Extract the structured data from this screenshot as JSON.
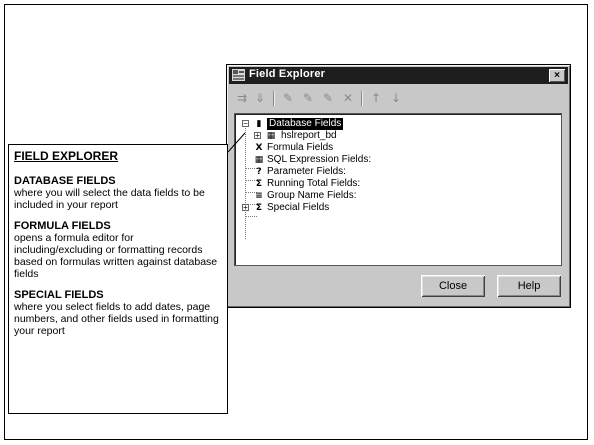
{
  "window": {
    "title": "Field Explorer",
    "close_glyph": "×",
    "toolbar_icons": [
      "insert-icon",
      "browse-icon",
      "new-icon",
      "edit-icon",
      "rename-icon",
      "delete-icon",
      "move-up-icon",
      "move-down-icon"
    ],
    "toolbar_glyphs": [
      "⇉",
      "⇓",
      "✎",
      "✎",
      "✎",
      "✕",
      "↑",
      "↓"
    ],
    "tree": [
      {
        "label": "Database Fields",
        "icon": "database-icon",
        "glyph": "▮",
        "expander": "−",
        "selected": true
      },
      {
        "label": "hslreport_bd",
        "icon": "table-icon",
        "glyph": "▦",
        "expander": "+",
        "selected": false
      },
      {
        "label": "Formula Fields",
        "icon": "formula-icon",
        "glyph": "X",
        "selected": false
      },
      {
        "label": "SQL Expression Fields:",
        "icon": "sql-icon",
        "glyph": "▦",
        "selected": false
      },
      {
        "label": "Parameter Fields:",
        "icon": "parameter-icon",
        "glyph": "?",
        "selected": false
      },
      {
        "label": "Running Total Fields:",
        "icon": "running-total-icon",
        "glyph": "Σ",
        "selected": false
      },
      {
        "label": "Group Name Fields:",
        "icon": "group-icon",
        "glyph": "≡",
        "selected": false
      },
      {
        "label": "Special Fields",
        "icon": "special-icon",
        "glyph": "Σ",
        "expander": "+",
        "selected": false
      }
    ],
    "buttons": {
      "close": "Close",
      "help": "Help"
    }
  },
  "info": {
    "heading": "FIELD EXPLORER",
    "sections": [
      {
        "title": "DATABASE FIELDS",
        "text": "where you will select the data fields to be included in your report"
      },
      {
        "title": "FORMULA FIELDS",
        "text": "opens a formula editor for including/excluding or formatting records based on formulas written against database fields"
      },
      {
        "title": "SPECIAL FIELDS",
        "text": "where you select fields to add dates, page numbers, and other fields used in formatting your report"
      }
    ]
  }
}
